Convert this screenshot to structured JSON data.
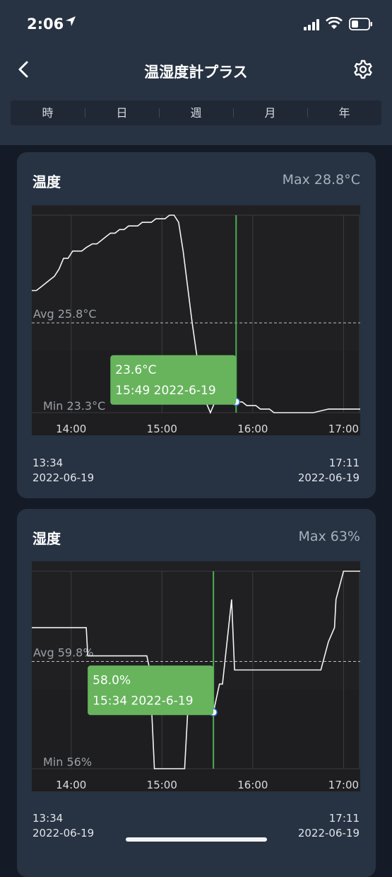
{
  "status_bar": {
    "time": "2:06"
  },
  "header": {
    "title": "温湿度計プラス"
  },
  "tabs": [
    "時",
    "日",
    "週",
    "月",
    "年"
  ],
  "cards": [
    {
      "title": "温度",
      "max_label": "Max 28.8°C",
      "avg_label": "Avg 25.8°C",
      "min_label": "Min 23.3°C",
      "tooltip": {
        "value": "23.6°C",
        "time": "15:49 2022-6-19"
      },
      "range_start": {
        "time": "13:34",
        "date": "2022-06-19"
      },
      "range_end": {
        "time": "17:11",
        "date": "2022-06-19"
      }
    },
    {
      "title": "湿度",
      "max_label": "Max 63%",
      "avg_label": "Avg 59.8%",
      "min_label": "Min 56%",
      "tooltip": {
        "value": "58.0%",
        "time": "15:34 2022-6-19"
      },
      "range_start": {
        "time": "13:34",
        "date": "2022-06-19"
      },
      "range_end": {
        "time": "17:11",
        "date": "2022-06-19"
      }
    }
  ],
  "chart_data": [
    {
      "type": "line",
      "ylim": [
        23.3,
        28.8
      ],
      "avg": 25.8,
      "highlight_x": "15:49",
      "highlight_y": 23.6,
      "xticks": [
        "14:00",
        "15:00",
        "16:00",
        "17:00"
      ],
      "x": [
        "13:34",
        "13:37",
        "13:40",
        "13:43",
        "13:46",
        "13:49",
        "13:52",
        "13:55",
        "13:58",
        "14:01",
        "14:04",
        "14:07",
        "14:10",
        "14:14",
        "14:17",
        "14:20",
        "14:23",
        "14:26",
        "14:29",
        "14:32",
        "14:35",
        "14:38",
        "14:41",
        "14:44",
        "14:47",
        "14:50",
        "14:53",
        "14:56",
        "14:59",
        "15:02",
        "15:05",
        "15:08",
        "15:11",
        "15:14",
        "15:17",
        "15:20",
        "15:23",
        "15:26",
        "15:29",
        "15:32",
        "15:35",
        "15:38",
        "15:41",
        "15:44",
        "15:47",
        "15:50",
        "15:53",
        "15:56",
        "15:59",
        "16:02",
        "16:05",
        "16:08",
        "16:11",
        "16:14",
        "16:17",
        "16:20",
        "16:30",
        "16:40",
        "16:50",
        "17:00",
        "17:11"
      ],
      "y": [
        26.7,
        26.7,
        26.8,
        26.9,
        27.0,
        27.1,
        27.3,
        27.6,
        27.6,
        27.8,
        27.8,
        27.8,
        27.9,
        28.0,
        28.0,
        28.1,
        28.2,
        28.3,
        28.3,
        28.4,
        28.4,
        28.5,
        28.5,
        28.5,
        28.6,
        28.6,
        28.6,
        28.7,
        28.7,
        28.7,
        28.8,
        28.8,
        28.6,
        27.8,
        26.8,
        25.8,
        24.9,
        24.1,
        23.6,
        23.3,
        23.6,
        23.8,
        23.8,
        23.7,
        23.6,
        23.6,
        23.6,
        23.5,
        23.5,
        23.5,
        23.4,
        23.4,
        23.4,
        23.3,
        23.3,
        23.3,
        23.3,
        23.3,
        23.4,
        23.4,
        23.4
      ]
    },
    {
      "type": "line",
      "ylim": [
        56,
        63
      ],
      "avg": 59.8,
      "highlight_x": "15:34",
      "highlight_y": 58.0,
      "xticks": [
        "14:00",
        "15:00",
        "16:00",
        "17:00"
      ],
      "x": [
        "13:34",
        "13:50",
        "14:10",
        "14:11",
        "14:25",
        "14:40",
        "14:50",
        "14:52",
        "14:55",
        "15:00",
        "15:05",
        "15:10",
        "15:15",
        "15:17",
        "15:25",
        "15:29",
        "15:34",
        "15:36",
        "15:38",
        "15:40",
        "15:42",
        "15:44",
        "15:46",
        "15:48",
        "15:51",
        "15:55",
        "16:05",
        "16:15",
        "16:25",
        "16:35",
        "16:45",
        "16:50",
        "16:54",
        "16:55",
        "17:00",
        "17:11"
      ],
      "y": [
        61.0,
        61.0,
        61.0,
        60.0,
        60.0,
        60.0,
        60.0,
        59.5,
        56.0,
        56.0,
        56.0,
        56.0,
        56.0,
        58.0,
        58.0,
        58.0,
        58.0,
        58.5,
        59.0,
        59.0,
        60.0,
        61.0,
        62.0,
        59.5,
        59.5,
        59.5,
        59.5,
        59.5,
        59.5,
        59.5,
        59.5,
        60.5,
        61.0,
        62.0,
        63.0,
        63.0
      ]
    }
  ]
}
